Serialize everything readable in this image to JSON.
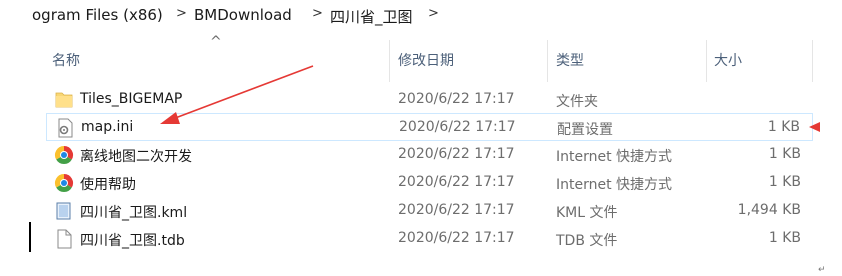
{
  "breadcrumb": [
    "ogram Files (x86)",
    "BMDownload",
    "四川省_卫图"
  ],
  "columns": {
    "name": "名称",
    "date": "修改日期",
    "type": "类型",
    "size": "大小"
  },
  "files": [
    {
      "name": "Tiles_BIGEMAP",
      "date": "2020/6/22 17:17",
      "type": "文件夹",
      "size": "",
      "icon": "folder-icon"
    },
    {
      "name": "map.ini",
      "date": "2020/6/22 17:17",
      "type": "配置设置",
      "size": "1 KB",
      "icon": "settings-file-icon"
    },
    {
      "name": "离线地图二次开发",
      "date": "2020/6/22 17:17",
      "type": "Internet 快捷方式",
      "size": "1 KB",
      "icon": "chrome-icon"
    },
    {
      "name": "使用帮助",
      "date": "2020/6/22 17:17",
      "type": "Internet 快捷方式",
      "size": "1 KB",
      "icon": "chrome-icon"
    },
    {
      "name": "四川省_卫图.kml",
      "date": "2020/6/22 17:17",
      "type": "KML 文件",
      "size": "1,494 KB",
      "icon": "kml-file-icon"
    },
    {
      "name": "四川省_卫图.tdb",
      "date": "2020/6/22 17:17",
      "type": "TDB 文件",
      "size": "1 KB",
      "icon": "blank-file-icon"
    }
  ],
  "colors": {
    "annotation": "#e53935",
    "header_text": "#4c607a",
    "selection_border": "#cde8ff"
  }
}
